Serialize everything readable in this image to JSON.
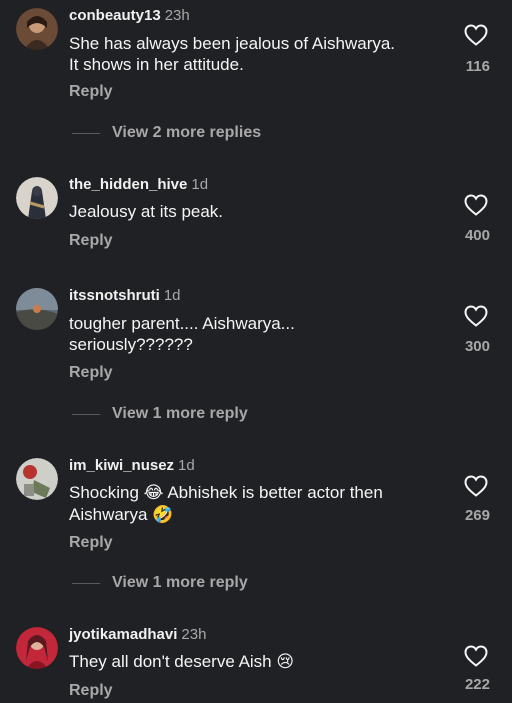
{
  "comments": [
    {
      "username": "conbeauty13",
      "time": "23h",
      "text_lines": [
        "She has always been jealous of Aishwarya.",
        "It shows in her attitude."
      ],
      "reply_label": "Reply",
      "likes": "116",
      "more_replies": "View 2 more replies"
    },
    {
      "username": "the_hidden_hive",
      "time": "1d",
      "text_lines": [
        "Jealousy at its peak."
      ],
      "reply_label": "Reply",
      "likes": "400"
    },
    {
      "username": "itssnotshruti",
      "time": "1d",
      "text_lines": [
        "tougher parent.... Aishwarya...",
        "seriously??????"
      ],
      "reply_label": "Reply",
      "likes": "300",
      "more_replies": "View 1 more reply"
    },
    {
      "username": "im_kiwi_nusez",
      "time": "1d",
      "text_lines": [
        "Shocking",
        "Abhishek is better actor then",
        "Aishwarya"
      ],
      "emojis": [
        "😂",
        "🤣"
      ],
      "reply_label": "Reply",
      "likes": "269",
      "more_replies": "View 1 more reply"
    },
    {
      "username": "jyotikamadhavi",
      "time": "23h",
      "text_lines": [
        "They all don't deserve Aish"
      ],
      "emojis": [
        "😢"
      ],
      "reply_label": "Reply",
      "likes": "222"
    }
  ],
  "icons": {
    "like": "heart-outline-icon"
  },
  "colors": {
    "background": "#202124",
    "primary_text": "#f5f5f5",
    "secondary_text": "#a8a8a8"
  }
}
